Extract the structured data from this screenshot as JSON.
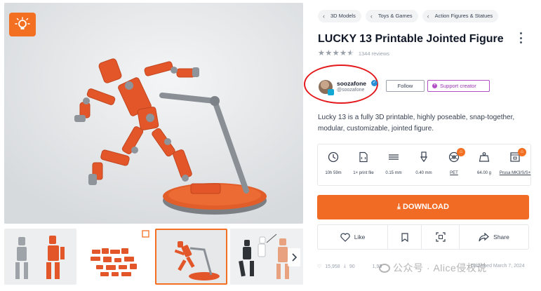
{
  "brand": {
    "accent": "#f36f21",
    "download_color": "#f26b25",
    "support_color": "#b14fc5",
    "annotation_ring_color": "#e5191c"
  },
  "icons": {
    "idea_badge": "lightbulb-icon",
    "thumb_next": "chevron-right-icon"
  },
  "breadcrumbs": [
    {
      "label": "3D Models"
    },
    {
      "label": "Toys & Games"
    },
    {
      "label": "Action Figures & Statues"
    }
  ],
  "model": {
    "title": "LUCKY 13 Printable Jointed Figure",
    "rating": {
      "stars": 4.5,
      "max": 5,
      "reviews_label": "1344 reviews"
    },
    "description": "Lucky 13 is a fully 3D printable, highly poseable, snap-together, modular, customizable, jointed figure."
  },
  "author": {
    "name": "soozafone",
    "handle": "@soozafone",
    "follow_label": "Follow",
    "support_label": "Support creator"
  },
  "specs": [
    {
      "icon": "clock-icon",
      "label": "10h 59m",
      "link": false,
      "badge": false
    },
    {
      "icon": "file-icon",
      "label": "1× print file",
      "link": false,
      "badge": false
    },
    {
      "icon": "layer-height-icon",
      "label": "0.15 mm",
      "link": false,
      "badge": false
    },
    {
      "icon": "nozzle-icon",
      "label": "0.40 mm",
      "link": false,
      "badge": false
    },
    {
      "icon": "filament-spool-icon",
      "label": "PET",
      "link": true,
      "badge": true
    },
    {
      "icon": "weight-icon",
      "label": "64.00 g",
      "link": false,
      "badge": false
    },
    {
      "icon": "printer-icon",
      "label": "Prusa MK3/S/S+",
      "link": true,
      "badge": true
    }
  ],
  "download": {
    "label": "DOWNLOAD",
    "icon": "download-icon"
  },
  "actions": [
    {
      "label": "Like",
      "icon": "heart-icon"
    },
    {
      "label": "",
      "icon": "bookmark-icon"
    },
    {
      "label": "",
      "icon": "ar-view-icon"
    },
    {
      "label": "Share",
      "icon": "share-icon"
    }
  ],
  "stats": {
    "likes": "15,958",
    "downloads_partial": "90",
    "views_partial": "1,93",
    "published_partial": "published March 7, 2024"
  },
  "watermark": {
    "text": "公众号 · Alice侵权说"
  }
}
